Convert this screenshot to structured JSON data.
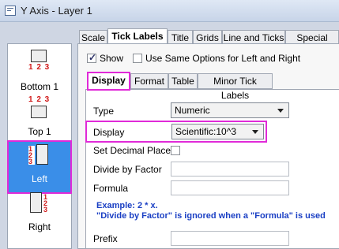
{
  "window": {
    "title": "Y Axis - Layer 1",
    "icon": "axis-dialog-icon"
  },
  "sidebar": {
    "items": [
      {
        "label": "Bottom 1",
        "numbers": "1 2 3"
      },
      {
        "label": "Top 1",
        "numbers": "1 2 3"
      },
      {
        "label": "Left",
        "numbers": "123",
        "selected": true
      },
      {
        "label": "Right",
        "numbers": "123"
      }
    ]
  },
  "tabs": [
    "Scale",
    "Tick Labels",
    "Title",
    "Grids",
    "Line and Ticks",
    "Special Ticks"
  ],
  "active_tab": "Tick Labels",
  "options": {
    "show_label": "Show",
    "show_checked": true,
    "same_options_label": "Use Same Options for Left and Right",
    "same_options_checked": false
  },
  "subtabs": [
    "Display",
    "Format",
    "Table",
    "Minor Tick Labels"
  ],
  "active_subtab": "Display",
  "form": {
    "type_label": "Type",
    "type_value": "Numeric",
    "display_label": "Display",
    "display_value": "Scientific:10^3",
    "decimal_label": "Set Decimal Places",
    "decimal_checked": false,
    "divide_label": "Divide by Factor",
    "divide_value": "",
    "formula_label": "Formula",
    "formula_value": "",
    "example_line1": "Example: 2 * x.",
    "example_line2": "\"Divide by Factor\" is ignored when a \"Formula\" is used",
    "prefix_label": "Prefix",
    "prefix_value": ""
  },
  "colors": {
    "highlight": "#e02ad8",
    "selected": "#3a8ee8",
    "note": "#1a3fc4",
    "axis_numbers": "#d11818"
  }
}
